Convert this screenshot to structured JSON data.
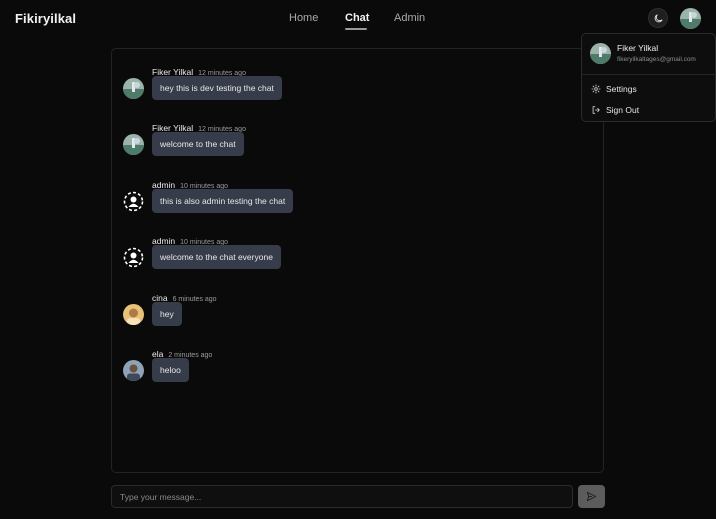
{
  "brand": "Fikiryilkal",
  "nav": [
    {
      "label": "Home",
      "active": false
    },
    {
      "label": "Chat",
      "active": true
    },
    {
      "label": "Admin",
      "active": false
    }
  ],
  "icons": {
    "theme": "moon-icon",
    "send": "send-icon",
    "settings": "gear-icon",
    "signout": "sign-out-icon"
  },
  "user_menu": {
    "name": "Fiker Yilkal",
    "email": "fikeryilkaltages@gmail.com",
    "items": [
      {
        "label": "Settings",
        "icon": "gear-icon"
      },
      {
        "label": "Sign Out",
        "icon": "sign-out-icon"
      }
    ]
  },
  "messages": [
    {
      "user": "Fiker Yilkal",
      "time": "12 minutes ago",
      "text": "hey this is dev testing the chat",
      "avatar": "landscape"
    },
    {
      "user": "Fiker Yilkal",
      "time": "12 minutes ago",
      "text": "welcome to the chat",
      "avatar": "landscape"
    },
    {
      "user": "admin",
      "time": "10 minutes ago",
      "text": "this is also admin testing the chat",
      "avatar": "default"
    },
    {
      "user": "admin",
      "time": "10 minutes ago",
      "text": "welcome to the chat everyone",
      "avatar": "default"
    },
    {
      "user": "cina",
      "time": "6 minutes ago",
      "text": "hey",
      "avatar": "photo-warm"
    },
    {
      "user": "ela",
      "time": "2 minutes ago",
      "text": "heloo",
      "avatar": "photo-cool"
    }
  ],
  "composer": {
    "placeholder": "Type your message..."
  },
  "colors": {
    "background": "#0b0a0a",
    "bubble": "#363c4a",
    "send_button": "#5c5c5c"
  }
}
